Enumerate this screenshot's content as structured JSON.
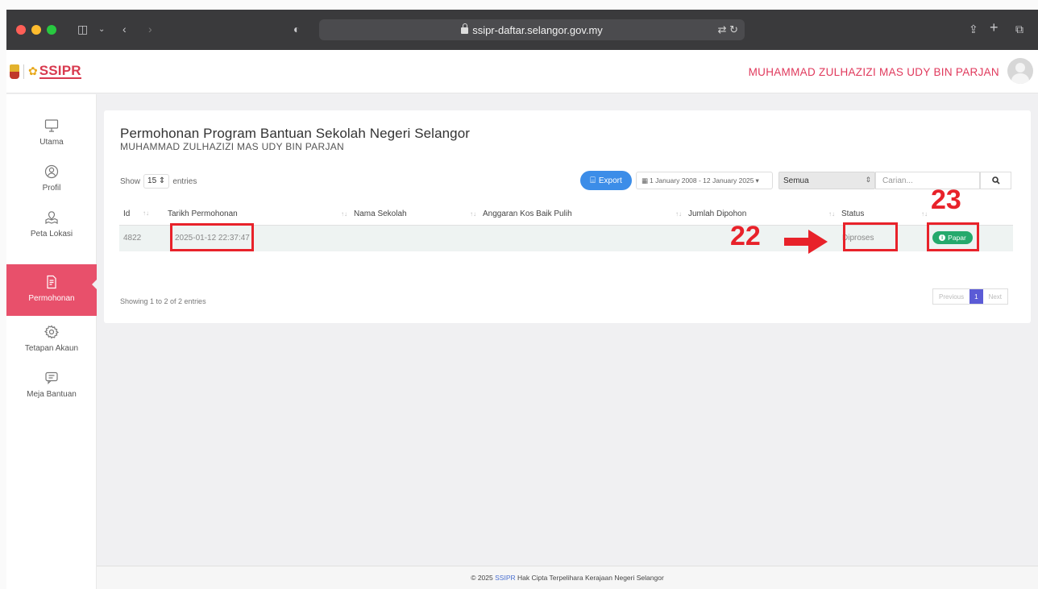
{
  "browser": {
    "url": "ssipr-daftar.selangor.gov.my"
  },
  "header": {
    "logo_text": "SSIPR",
    "user_name": "MUHAMMAD ZULHAZIZI MAS UDY BIN PARJAN"
  },
  "sidebar": {
    "items": [
      {
        "label": "Utama",
        "icon": "monitor-icon"
      },
      {
        "label": "Profil",
        "icon": "user-icon"
      },
      {
        "label": "Peta Lokasi",
        "icon": "map-pin-icon"
      },
      {
        "label": "Permohonan",
        "icon": "document-icon",
        "active": true
      },
      {
        "label": "Tetapan Akaun",
        "icon": "gear-icon"
      },
      {
        "label": "Meja Bantuan",
        "icon": "chat-icon"
      }
    ]
  },
  "main": {
    "title": "Permohonan Program Bantuan Sekolah Negeri Selangor",
    "subtitle": "MUHAMMAD ZULHAZIZI MAS UDY BIN PARJAN",
    "show_label": "Show",
    "entries_value": "15",
    "entries_label": "entries",
    "export_label": "Export",
    "date_range": "1 January 2008 - 12 January 2025",
    "status_filter": "Semua",
    "search_placeholder": "Carian...",
    "table": {
      "headers": [
        "Id",
        "Tarikh Permohonan",
        "Nama Sekolah",
        "Anggaran Kos Baik Pulih",
        "Jumlah Dipohon",
        "Status"
      ],
      "rows": [
        {
          "id": "4822",
          "tarikh": "2025-01-12 22:37:47",
          "nama": "",
          "anggaran": "",
          "jumlah": "",
          "status": "Diproses",
          "action": "Papar"
        }
      ]
    },
    "info": "Showing 1 to 2 of 2 entries",
    "pager": {
      "prev": "Previous",
      "current": "1",
      "next": "Next"
    }
  },
  "footer": {
    "prefix": "© 2025",
    "brand": "SSIPR",
    "suffix": "Hak Cipta Terpelihara Kerajaan Negeri Selangor"
  },
  "annotations": {
    "step_22": "22",
    "step_23": "23",
    "color": "#e8222a"
  }
}
